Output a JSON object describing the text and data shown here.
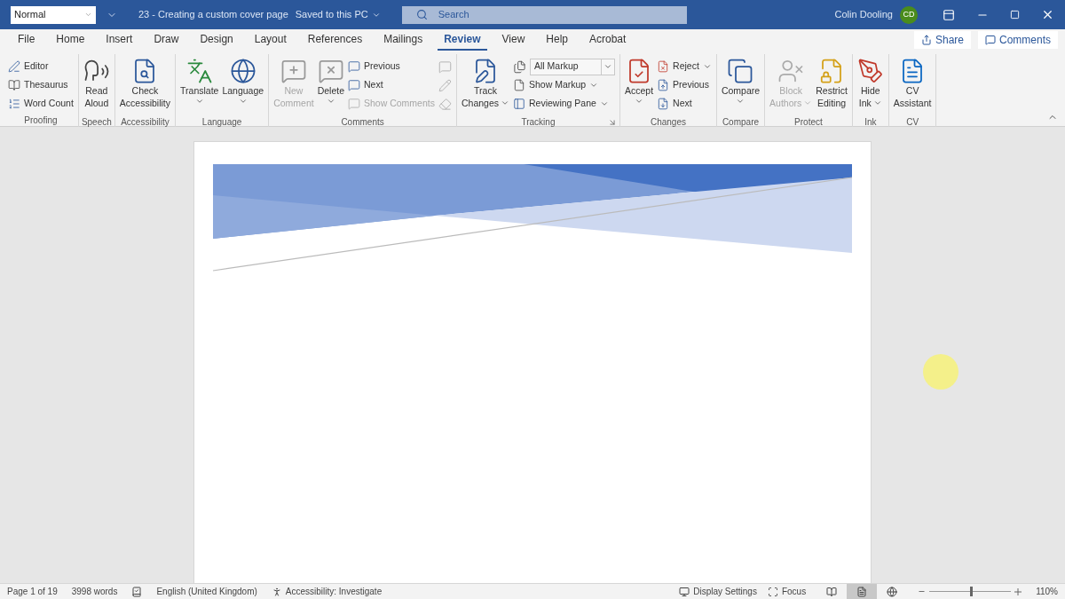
{
  "title_bar": {
    "style_box": "Normal",
    "document_title": "23 - Creating a custom cover page",
    "save_status": "Saved to this PC",
    "search": {
      "placeholder": "Search"
    },
    "user": {
      "name": "Colin Dooling",
      "initials": "CD"
    }
  },
  "tabs": [
    {
      "label": "File",
      "selected": false
    },
    {
      "label": "Home",
      "selected": false
    },
    {
      "label": "Insert",
      "selected": false
    },
    {
      "label": "Draw",
      "selected": false
    },
    {
      "label": "Design",
      "selected": false
    },
    {
      "label": "Layout",
      "selected": false
    },
    {
      "label": "References",
      "selected": false
    },
    {
      "label": "Mailings",
      "selected": false
    },
    {
      "label": "Review",
      "selected": true
    },
    {
      "label": "View",
      "selected": false
    },
    {
      "label": "Help",
      "selected": false
    },
    {
      "label": "Acrobat",
      "selected": false
    }
  ],
  "share_button": "Share",
  "comments_button": "Comments",
  "ribbon_groups": [
    {
      "label": "Proofing",
      "controls": [
        {
          "kind": "stack",
          "items": [
            {
              "kind": "small",
              "label": "Editor",
              "disabled": false,
              "dropdown": false
            },
            {
              "kind": "small",
              "label": "Thesaurus",
              "disabled": false,
              "dropdown": false
            },
            {
              "kind": "small",
              "label": "Word Count",
              "disabled": false,
              "dropdown": false
            }
          ]
        }
      ]
    },
    {
      "label": "Speech",
      "controls": [
        {
          "kind": "large",
          "lines": [
            "Read",
            "Aloud"
          ],
          "disabled": false,
          "dropdown": false
        }
      ]
    },
    {
      "label": "Accessibility",
      "controls": [
        {
          "kind": "large",
          "lines": [
            "Check",
            "Accessibility"
          ],
          "disabled": false,
          "dropdown": false
        }
      ]
    },
    {
      "label": "Language",
      "controls": [
        {
          "kind": "large",
          "lines": [
            "Translate"
          ],
          "disabled": false,
          "dropdown": true
        },
        {
          "kind": "large",
          "lines": [
            "Language"
          ],
          "disabled": false,
          "dropdown": true
        }
      ]
    },
    {
      "label": "Comments",
      "controls": [
        {
          "kind": "large",
          "lines": [
            "New",
            "Comment"
          ],
          "disabled": true,
          "dropdown": false
        },
        {
          "kind": "large",
          "lines": [
            "Delete"
          ],
          "disabled": false,
          "dropdown": true
        },
        {
          "kind": "stack",
          "items": [
            {
              "kind": "small",
              "label": "Previous",
              "disabled": false,
              "dropdown": false
            },
            {
              "kind": "small",
              "label": "Next",
              "disabled": false,
              "dropdown": false
            },
            {
              "kind": "small",
              "label": "Show Comments",
              "disabled": true,
              "dropdown": false
            }
          ]
        },
        {
          "kind": "stack",
          "items": [
            {
              "kind": "icon",
              "disabled": true
            },
            {
              "kind": "icon",
              "disabled": true
            },
            {
              "kind": "icon",
              "disabled": true
            }
          ]
        }
      ]
    },
    {
      "label": "Tracking",
      "launcher": true,
      "controls": [
        {
          "kind": "large",
          "lines": [
            "Track",
            "Changes"
          ],
          "disabled": false,
          "dropdown": true
        },
        {
          "kind": "stack",
          "items": [
            {
              "kind": "combo",
              "label": "All Markup",
              "disabled": false,
              "dropdown": true
            },
            {
              "kind": "small",
              "label": "Show Markup",
              "disabled": false,
              "dropdown": true
            },
            {
              "kind": "small",
              "label": "Reviewing Pane",
              "disabled": false,
              "dropdown": true
            }
          ]
        }
      ]
    },
    {
      "label": "Changes",
      "controls": [
        {
          "kind": "large",
          "lines": [
            "Accept"
          ],
          "disabled": false,
          "dropdown": true
        },
        {
          "kind": "stack",
          "items": [
            {
              "kind": "small",
              "label": "Reject",
              "disabled": false,
              "dropdown": true
            },
            {
              "kind": "small",
              "label": "Previous",
              "disabled": false,
              "dropdown": false
            },
            {
              "kind": "small",
              "label": "Next",
              "disabled": false,
              "dropdown": false
            }
          ]
        }
      ]
    },
    {
      "label": "Compare",
      "controls": [
        {
          "kind": "large",
          "lines": [
            "Compare"
          ],
          "disabled": false,
          "dropdown": true
        }
      ]
    },
    {
      "label": "Protect",
      "controls": [
        {
          "kind": "large",
          "lines": [
            "Block",
            "Authors"
          ],
          "disabled": true,
          "dropdown": true
        },
        {
          "kind": "large",
          "lines": [
            "Restrict",
            "Editing"
          ],
          "disabled": false,
          "dropdown": false
        }
      ]
    },
    {
      "label": "Ink",
      "controls": [
        {
          "kind": "large",
          "lines": [
            "Hide",
            "Ink"
          ],
          "disabled": false,
          "dropdown": true
        }
      ]
    },
    {
      "label": "CV",
      "controls": [
        {
          "kind": "large",
          "lines": [
            "CV",
            "Assistant"
          ],
          "disabled": false,
          "dropdown": false
        }
      ]
    }
  ],
  "status_bar": {
    "page": "Page 1 of 19",
    "words": "3998 words",
    "language": "English (United Kingdom)",
    "accessibility": "Accessibility: Investigate",
    "display_settings": "Display Settings",
    "focus": "Focus",
    "views": [
      {
        "kind": "read",
        "selected": false
      },
      {
        "kind": "print",
        "selected": true
      },
      {
        "kind": "web",
        "selected": false
      }
    ],
    "zoom": {
      "level": 0.5,
      "reading": "110%"
    }
  }
}
